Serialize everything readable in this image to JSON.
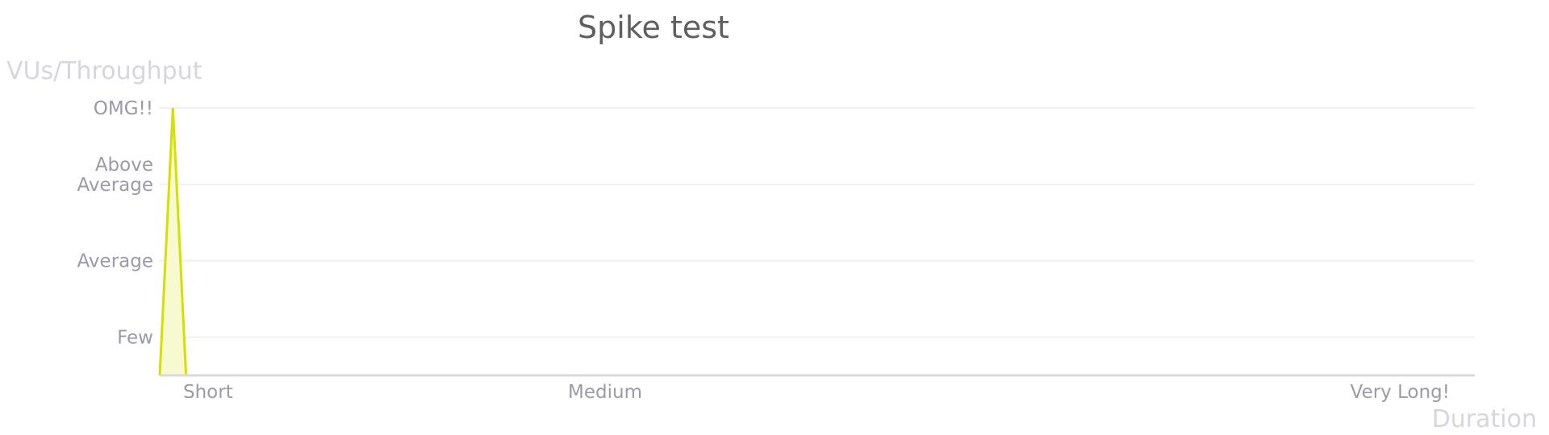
{
  "chart_data": {
    "type": "area",
    "title": "Spike test",
    "ylabel": "VUs/Throughput",
    "xlabel": "Duration",
    "x_ticks": [
      "Short",
      "Medium",
      "Very Long!"
    ],
    "y_ticks": [
      "Few",
      "Average",
      "Above\nAverage",
      "OMG!!"
    ],
    "y_ticks_display": [
      {
        "lines": [
          "Few"
        ]
      },
      {
        "lines": [
          "Average"
        ]
      },
      {
        "lines": [
          "Above",
          "Average"
        ]
      },
      {
        "lines": [
          "OMG!!"
        ]
      }
    ],
    "x_range": [
      0,
      100
    ],
    "y_range": [
      0,
      3.5
    ],
    "series": [
      {
        "points": [
          [
            0,
            0
          ],
          [
            1,
            3.5
          ],
          [
            2,
            0
          ]
        ]
      }
    ],
    "grid": true,
    "colors": {
      "series_line": "#d4e000",
      "series_fill": "#f7f9d0",
      "title": "#5f5f5f",
      "axis_title": "#d6d6e0",
      "tick_label": "#9b9aa8",
      "grid": "#f0f0f2",
      "axis": "#d8d8dc"
    }
  }
}
